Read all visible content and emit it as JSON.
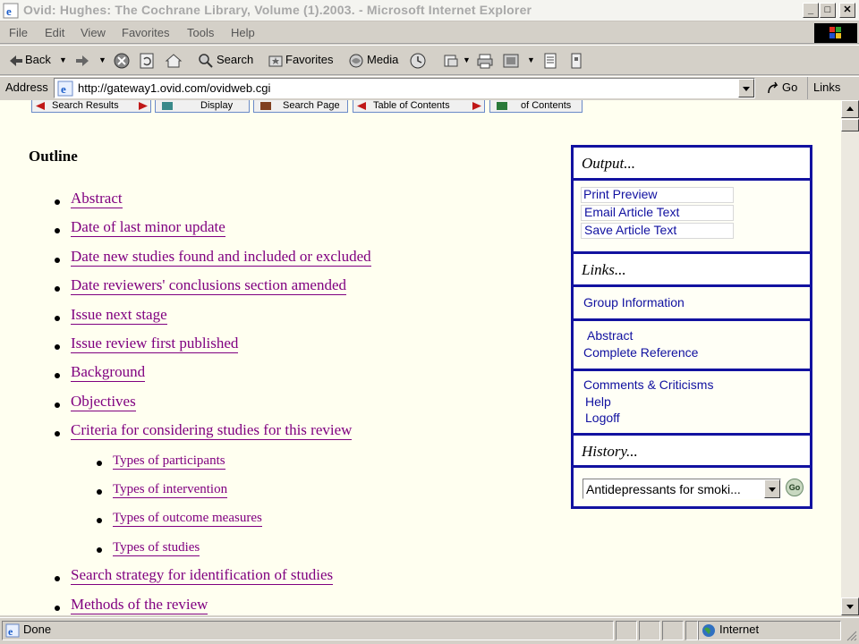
{
  "window": {
    "title": "Ovid: Hughes: The Cochrane Library, Volume (1).2003. - Microsoft Internet Explorer",
    "min_glyph": "_",
    "max_glyph": "□",
    "close_glyph": "✕"
  },
  "menu": [
    "File",
    "Edit",
    "View",
    "Favorites",
    "Tools",
    "Help"
  ],
  "toolbar": {
    "back": "Back",
    "search": "Search",
    "favorites": "Favorites",
    "media": "Media"
  },
  "address": {
    "label": "Address",
    "url": "http://gateway1.ovid.com/ovidweb.cgi",
    "go": "Go",
    "links": "Links"
  },
  "nav_strip": [
    "Search Results",
    "Display",
    "Search Page",
    "Table of Contents",
    "of Contents"
  ],
  "outline": {
    "title": "Outline",
    "items": [
      {
        "label": "Abstract",
        "level": 1
      },
      {
        "label": "Date of last minor update",
        "level": 1
      },
      {
        "label": "Date new studies found and included or excluded",
        "level": 1
      },
      {
        "label": "Date reviewers' conclusions section amended",
        "level": 1
      },
      {
        "label": "Issue next stage",
        "level": 1
      },
      {
        "label": "Issue review first published",
        "level": 1
      },
      {
        "label": "Background",
        "level": 1
      },
      {
        "label": "Objectives",
        "level": 1
      },
      {
        "label": "Criteria for considering studies for this review",
        "level": 1
      },
      {
        "label": "Types of participants",
        "level": 2
      },
      {
        "label": "Types of intervention",
        "level": 2
      },
      {
        "label": "Types of outcome measures",
        "level": 2
      },
      {
        "label": "Types of studies",
        "level": 2
      },
      {
        "label": "Search strategy for identification of studies",
        "level": 1
      },
      {
        "label": "Methods of the review",
        "level": 1
      }
    ]
  },
  "panel": {
    "output_header": "Output...",
    "output_links": [
      "Print Preview",
      "Email Article Text",
      "Save Article Text"
    ],
    "links_header": "Links...",
    "group_info": "Group Information",
    "abstract": "Abstract",
    "complete_ref": "Complete Reference",
    "comments": "Comments & Criticisms",
    "help": "Help",
    "logoff": "Logoff",
    "history_header": "History...",
    "history_select": "Antidepressants for smoki...",
    "history_go": "Go"
  },
  "status": {
    "text": "Done",
    "zone": "Internet"
  },
  "colors": {
    "link_visited": "#800080",
    "panel_border": "#1212a0",
    "panel_link": "#1010a0",
    "page_bg": "#fffff0"
  }
}
